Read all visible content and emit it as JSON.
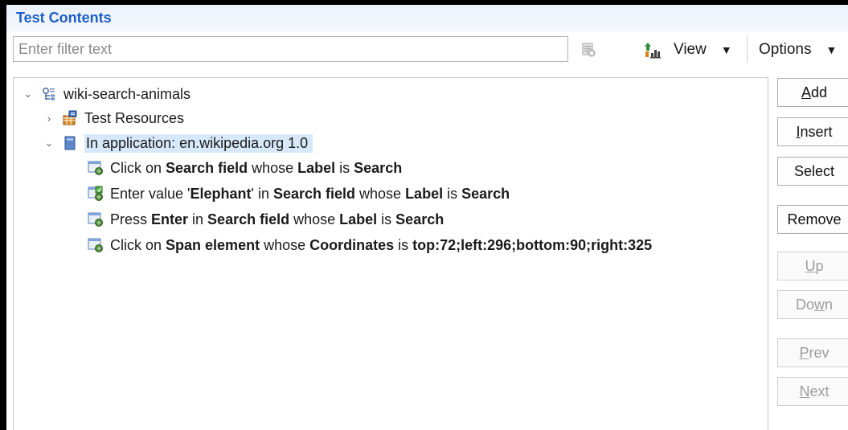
{
  "section": {
    "title": "Test Contents"
  },
  "filter": {
    "placeholder": "Enter filter text",
    "value": ""
  },
  "toolbar": {
    "view_label": "View",
    "options_label": "Options",
    "dropdown_arrow": "▼"
  },
  "tree": {
    "expand_arrow": "⌄",
    "collapse_arrow": "›",
    "root": {
      "label": "wiki-search-animals",
      "icon": "test-suite-icon",
      "expanded": true
    },
    "resources": {
      "label": "Test Resources",
      "icon": "resources-icon",
      "expanded": false
    },
    "app": {
      "label": "In application: en.wikipedia.org  1.0",
      "icon": "application-icon",
      "expanded": true,
      "selected": true
    },
    "steps": [
      {
        "icon": "web-action-icon",
        "parts": [
          {
            "t": "Click on ",
            "b": false
          },
          {
            "t": "Search field",
            "b": true
          },
          {
            "t": " whose ",
            "b": false
          },
          {
            "t": "Label",
            "b": true
          },
          {
            "t": " is ",
            "b": false
          },
          {
            "t": "Search",
            "b": true
          }
        ]
      },
      {
        "icon": "enter-value-icon",
        "parts": [
          {
            "t": "Enter value '",
            "b": false
          },
          {
            "t": "Elephant",
            "b": true
          },
          {
            "t": "' in ",
            "b": false
          },
          {
            "t": "Search field",
            "b": true
          },
          {
            "t": " whose ",
            "b": false
          },
          {
            "t": "Label",
            "b": true
          },
          {
            "t": " is ",
            "b": false
          },
          {
            "t": "Search",
            "b": true
          }
        ]
      },
      {
        "icon": "web-action-icon",
        "parts": [
          {
            "t": "Press ",
            "b": false
          },
          {
            "t": "Enter",
            "b": true
          },
          {
            "t": " in ",
            "b": false
          },
          {
            "t": "Search field",
            "b": true
          },
          {
            "t": " whose ",
            "b": false
          },
          {
            "t": "Label",
            "b": true
          },
          {
            "t": " is ",
            "b": false
          },
          {
            "t": "Search",
            "b": true
          }
        ]
      },
      {
        "icon": "web-action-icon",
        "parts": [
          {
            "t": "Click on ",
            "b": false
          },
          {
            "t": "Span element",
            "b": true
          },
          {
            "t": " whose ",
            "b": false
          },
          {
            "t": "Coordinates",
            "b": true
          },
          {
            "t": " is ",
            "b": false
          },
          {
            "t": "top:72;left:296;bottom:90;right:325",
            "b": true
          }
        ]
      }
    ]
  },
  "side_buttons": [
    {
      "key": "add",
      "pre": "",
      "mn": "A",
      "post": "dd",
      "enabled": true
    },
    {
      "key": "insert",
      "pre": "",
      "mn": "I",
      "post": "nsert",
      "enabled": true
    },
    {
      "key": "select",
      "pre": "",
      "mn": "",
      "post": "Select",
      "enabled": true
    },
    {
      "key": "remove",
      "pre": "",
      "mn": "",
      "post": "Remove",
      "enabled": true
    },
    {
      "key": "up",
      "pre": "",
      "mn": "U",
      "post": "p",
      "enabled": false
    },
    {
      "key": "down",
      "pre": "Do",
      "mn": "w",
      "post": "n",
      "enabled": false
    },
    {
      "key": "prev",
      "pre": "",
      "mn": "P",
      "post": "rev",
      "enabled": false
    },
    {
      "key": "next",
      "pre": "",
      "mn": "N",
      "post": "ext",
      "enabled": false
    }
  ],
  "colors": {
    "title": "#1d5ec9",
    "selection": "#d6e8f9",
    "disabled_text": "#9c9c9c"
  }
}
